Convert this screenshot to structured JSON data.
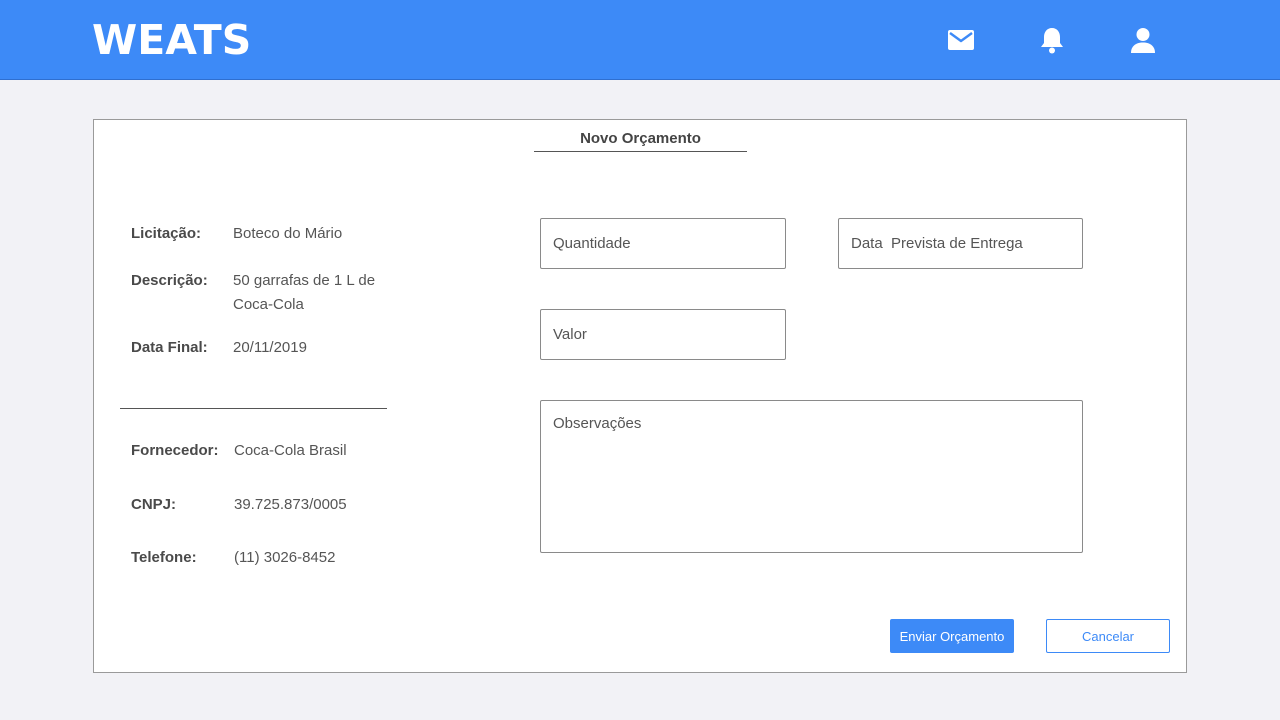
{
  "header": {
    "brand": "WEATS",
    "icons": [
      "mail-icon",
      "bell-icon",
      "user-icon"
    ],
    "background": "#3d8af7"
  },
  "panel": {
    "title": "Novo Orçamento"
  },
  "info": {
    "licitacao_label": "Licitação:",
    "licitacao_value": "Boteco do Mário",
    "descricao_label": "Descrição:",
    "descricao_line1": "50 garrafas de 1 L de",
    "descricao_line2": "Coca-Cola",
    "data_final_label": "Data Final:",
    "data_final_value": "20/11/2019"
  },
  "supplier": {
    "fornecedor_label": "Fornecedor:",
    "fornecedor_value": "Coca-Cola Brasil",
    "cnpj_label": "CNPJ:",
    "cnpj_value": "39.725.873/0005",
    "telefone_label": "Telefone:",
    "telefone_value": "(11) 3026-8452"
  },
  "form": {
    "quantidade_placeholder": "Quantidade",
    "quantidade_value": "",
    "data_entrega_placeholder": "Data  Prevista de Entrega",
    "data_entrega_value": "",
    "valor_placeholder": "Valor",
    "valor_value": "",
    "observacoes_placeholder": "Observações",
    "observacoes_value": ""
  },
  "actions": {
    "submit_label": "Enviar Orçamento",
    "cancel_label": "Cancelar"
  },
  "colors": {
    "accent": "#3d8af7",
    "page_bg": "#f2f2f6"
  }
}
